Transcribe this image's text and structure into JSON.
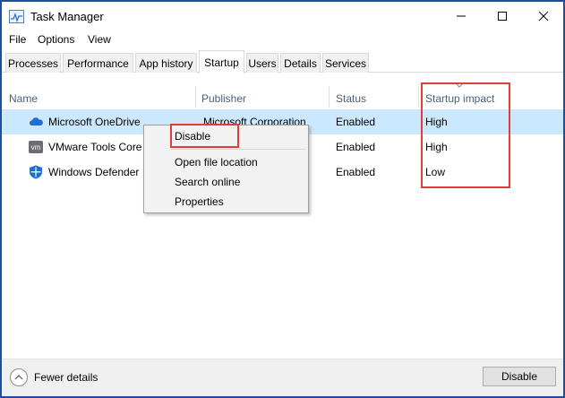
{
  "window": {
    "title": "Task Manager"
  },
  "menu": [
    "File",
    "Options",
    "View"
  ],
  "tabs": [
    "Processes",
    "Performance",
    "App history",
    "Startup",
    "Users",
    "Details",
    "Services"
  ],
  "active_tab": "Startup",
  "columns": {
    "name": "Name",
    "publisher": "Publisher",
    "status": "Status",
    "impact": "Startup impact"
  },
  "rows": [
    {
      "name": "Microsoft OneDrive",
      "publisher": "Microsoft Corporation",
      "status": "Enabled",
      "impact": "High",
      "icon": "onedrive-icon"
    },
    {
      "name": "VMware Tools Core",
      "publisher": "",
      "status": "Enabled",
      "impact": "High",
      "icon": "vmware-icon"
    },
    {
      "name": "Windows Defender",
      "publisher": "",
      "status": "Enabled",
      "impact": "Low",
      "icon": "windows-defender-icon"
    }
  ],
  "context_menu": [
    "Disable",
    "Open file location",
    "Search online",
    "Properties"
  ],
  "footer": {
    "fewer_details": "Fewer details",
    "disable_button": "Disable"
  },
  "colors": {
    "selected_row": "#cce8ff",
    "highlight": "#e23b3b",
    "header_text": "#4c607a",
    "border": "#1c4fa0"
  }
}
